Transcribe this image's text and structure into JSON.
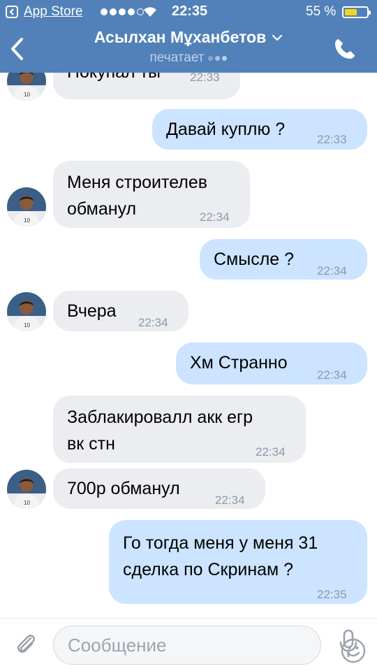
{
  "status_bar": {
    "back_app": "App Store",
    "time": "22:35",
    "battery": "55 %",
    "battery_level": 0.55
  },
  "header": {
    "title": "Асылхан Мұханбетов",
    "subtitle": "печатает"
  },
  "messages": [
    {
      "dir": "in",
      "lines": [
        "Покупал ты"
      ],
      "time": "22:33",
      "avatar": true
    },
    {
      "dir": "out",
      "lines": [
        "Давай куплю ?"
      ],
      "time": "22:33"
    },
    {
      "dir": "in",
      "lines": [
        "Меня строителев",
        "обманул"
      ],
      "time": "22:34",
      "avatar": true
    },
    {
      "dir": "out",
      "lines": [
        "Смысле ?"
      ],
      "time": "22:34"
    },
    {
      "dir": "in",
      "lines": [
        "Вчера"
      ],
      "time": "22:34",
      "avatar": true
    },
    {
      "dir": "out",
      "lines": [
        "Хм Странно"
      ],
      "time": "22:34"
    },
    {
      "dir": "in",
      "lines": [
        "Заблакировалл акк егр",
        "вк стн"
      ],
      "time": "22:34",
      "avatar": false
    },
    {
      "dir": "in",
      "lines": [
        "700р обманул"
      ],
      "time": "22:34",
      "avatar": true
    },
    {
      "dir": "out",
      "lines": [
        "Го тогда меня у меня 31",
        "сделка по Скринам ?"
      ],
      "time": "22:35"
    }
  ],
  "composer": {
    "placeholder": "Сообщение"
  },
  "icons": {
    "back": "chevron-left-icon",
    "call": "phone-icon",
    "attach": "paperclip-icon",
    "emoji": "smile-icon",
    "voice": "microphone-icon"
  },
  "colors": {
    "header": "#5181b8",
    "incoming_bubble": "#ebedf0",
    "outgoing_bubble": "#cce4ff"
  }
}
